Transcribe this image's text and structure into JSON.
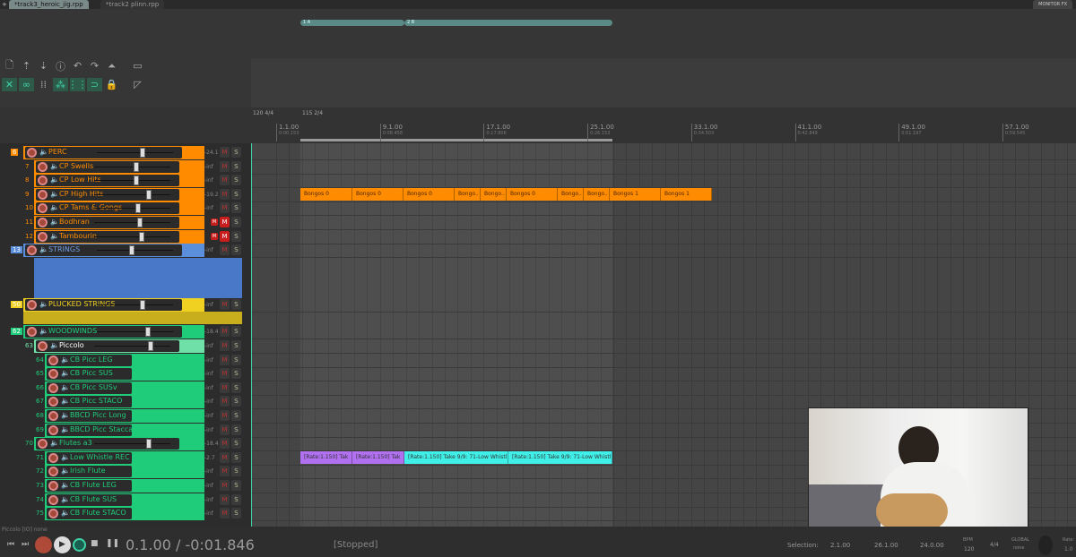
{
  "tabs": [
    {
      "label": "*track3_heroic_jig.rpp",
      "active": true
    },
    {
      "label": "*track2  plinn.rpp",
      "active": false
    }
  ],
  "monitor_fx": "MONITOR FX",
  "regions": [
    {
      "label": "1  A"
    },
    {
      "label": "2  B"
    }
  ],
  "toolbar": {
    "row1": [
      "new-file-icon",
      "save-upload-icon",
      "download-icon",
      "info-icon",
      "undo-icon",
      "redo-icon",
      "metronome-icon",
      "grid-box-icon"
    ],
    "row2": [
      "ripple-icon",
      "link-icon",
      "grid-dots-icon",
      "group-icon",
      "snap-grid-icon",
      "magnet-icon",
      "lock-icon",
      "ruler-icon"
    ]
  },
  "tempo_markers": [
    "120 4/4",
    "115 2/4"
  ],
  "ruler": [
    {
      "bar": "1.1.00",
      "time": "0:00.153"
    },
    {
      "bar": "9.1.00",
      "time": "0:08.458"
    },
    {
      "bar": "17.1.00",
      "time": "0:17.806"
    },
    {
      "bar": "25.1.00",
      "time": "0:26.153"
    },
    {
      "bar": "33.1.00",
      "time": "0:34.503"
    },
    {
      "bar": "41.1.00",
      "time": "0:42.849"
    },
    {
      "bar": "49.1.00",
      "time": "0:51.197"
    },
    {
      "bar": "57.1.00",
      "time": "0:59.545"
    }
  ],
  "tracks": [
    {
      "num": "6",
      "name": "PERC",
      "color": "#ff8c00",
      "text": "#ff8c00",
      "depth": 0,
      "folder": true,
      "fader": 0.6,
      "vol": "-24.1",
      "mute": false
    },
    {
      "num": "7",
      "name": "CP Swells",
      "color": "#ff8c00",
      "text": "#ff8c00",
      "depth": 1,
      "fader": 0.55,
      "vol": "-inf",
      "mute": false
    },
    {
      "num": "8",
      "name": "CP Low Hits",
      "color": "#ff8c00",
      "text": "#ff8c00",
      "depth": 1,
      "fader": 0.55,
      "vol": "-inf",
      "mute": false
    },
    {
      "num": "9",
      "name": "CP High Hits",
      "color": "#ff8c00",
      "text": "#ff8c00",
      "depth": 1,
      "fader": 0.72,
      "vol": "-19.2",
      "mute": false
    },
    {
      "num": "10",
      "name": "CP Tams & Gongs",
      "color": "#ff8c00",
      "text": "#ff8c00",
      "depth": 1,
      "fader": 0.58,
      "vol": "-inf",
      "mute": false
    },
    {
      "num": "11",
      "name": "Bodhran",
      "color": "#ff8c00",
      "text": "#ff8c00",
      "depth": 1,
      "fader": 0.6,
      "vol": "",
      "mute": true
    },
    {
      "num": "12",
      "name": "Tambourin",
      "color": "#ff8c00",
      "text": "#ff8c00",
      "depth": 1,
      "fader": 0.63,
      "vol": "",
      "mute": true
    },
    {
      "num": "13",
      "name": "STRINGS",
      "color": "#5b8fdc",
      "text": "#6f9ee8",
      "depth": 0,
      "folder": true,
      "fader": 0.45,
      "vol": "-inf",
      "mute": false,
      "collapsed_height": "big"
    },
    {
      "num": "50",
      "name": "PLUCKED STRINGS",
      "color": "#f0d020",
      "text": "#f0d020",
      "depth": 0,
      "folder": true,
      "fader": 0.6,
      "vol": "-inf",
      "mute": false,
      "collapsed_height": "small"
    },
    {
      "num": "62",
      "name": "WOODWINDS",
      "color": "#1fcc7a",
      "text": "#1fcc7a",
      "depth": 0,
      "folder": true,
      "fader": 0.68,
      "vol": "-18.4",
      "mute": false
    },
    {
      "num": "63",
      "name": "Piccolo",
      "color": "#6fe0a8",
      "text": "#ffffff",
      "depth": 1,
      "folder": true,
      "fader": 0.75,
      "vol": "-inf",
      "mute": false
    },
    {
      "num": "64",
      "name": "CB Picc LEG",
      "color": "#1fcc7a",
      "text": "#1fcc7a",
      "depth": 2,
      "vol": "-inf",
      "mute": false
    },
    {
      "num": "65",
      "name": "CB Picc SUS",
      "color": "#1fcc7a",
      "text": "#1fcc7a",
      "depth": 2,
      "vol": "-inf",
      "mute": false
    },
    {
      "num": "66",
      "name": "CB Picc SUSv",
      "color": "#1fcc7a",
      "text": "#1fcc7a",
      "depth": 2,
      "vol": "-inf",
      "mute": false
    },
    {
      "num": "67",
      "name": "CB Picc STACO",
      "color": "#1fcc7a",
      "text": "#1fcc7a",
      "depth": 2,
      "vol": "-inf",
      "mute": false
    },
    {
      "num": "68",
      "name": "BBCD Picc Long",
      "color": "#1fcc7a",
      "text": "#1fcc7a",
      "depth": 2,
      "vol": "-inf",
      "mute": false
    },
    {
      "num": "69",
      "name": "BBCD Picc Staccatis",
      "color": "#1fcc7a",
      "text": "#1fcc7a",
      "depth": 2,
      "vol": "-inf",
      "mute": false
    },
    {
      "num": "70",
      "name": "Flutes a3",
      "color": "#1fcc7a",
      "text": "#1fcc7a",
      "depth": 1,
      "folder": true,
      "fader": 0.72,
      "vol": "-18.4",
      "mute": false
    },
    {
      "num": "71",
      "name": "Low Whistle REC",
      "color": "#1fcc7a",
      "text": "#1fcc7a",
      "depth": 2,
      "vol": "-2.7",
      "mute": false
    },
    {
      "num": "72",
      "name": "Irish Flute",
      "color": "#1fcc7a",
      "text": "#1fcc7a",
      "depth": 2,
      "vol": "-inf",
      "mute": false
    },
    {
      "num": "73",
      "name": "CB Flute LEG",
      "color": "#1fcc7a",
      "text": "#1fcc7a",
      "depth": 2,
      "vol": "-inf",
      "mute": false
    },
    {
      "num": "74",
      "name": "CB Flute SUS",
      "color": "#1fcc7a",
      "text": "#1fcc7a",
      "depth": 2,
      "vol": "-inf",
      "mute": false
    },
    {
      "num": "75",
      "name": "CB Flute STACO",
      "color": "#1fcc7a",
      "text": "#1fcc7a",
      "depth": 2,
      "vol": "-inf",
      "mute": false
    }
  ],
  "mute_label": "M",
  "solo_label": "S",
  "items": {
    "bongos": [
      "Bongos 0",
      "Bongos 0",
      "Bongos 0",
      "Bongo..",
      "Bongo..",
      "Bongos 0",
      "Bongo..",
      "Bongo..",
      "Bongos 1",
      "Bongos 1"
    ],
    "whistle": [
      "[Rate:1.150] Tak",
      "[Rate:1.150] Tak",
      "[Rate:1.150] Take 9/9: 71-Low Whistl...",
      "[Rate:1.150] Take 9/9: 71-Low Whistl..."
    ]
  },
  "status_line": "Piccolo [IO] none",
  "transport": {
    "position": "0.1.00 / -0:01.846",
    "state": "[Stopped]",
    "selection_label": "Selection:",
    "sel_start": "2.1.00",
    "sel_end": "26.1.00",
    "sel_len": "24.0.00",
    "bpm_label": "BPM",
    "bpm": "120",
    "timesig": "4/4",
    "global_label": "GLOBAL",
    "global_mode": "none",
    "rate_label": "Rate:",
    "rate": "1.0"
  },
  "colors": {
    "accent": "#3fd3a8",
    "perc": "#ff8c00",
    "strings": "#5b8fdc",
    "plucked": "#f0d020",
    "woodwinds": "#1fcc7a",
    "whistle_purple": "#b070f0",
    "whistle_cyan": "#40f0e8",
    "mute_on": "#c81e1e"
  }
}
